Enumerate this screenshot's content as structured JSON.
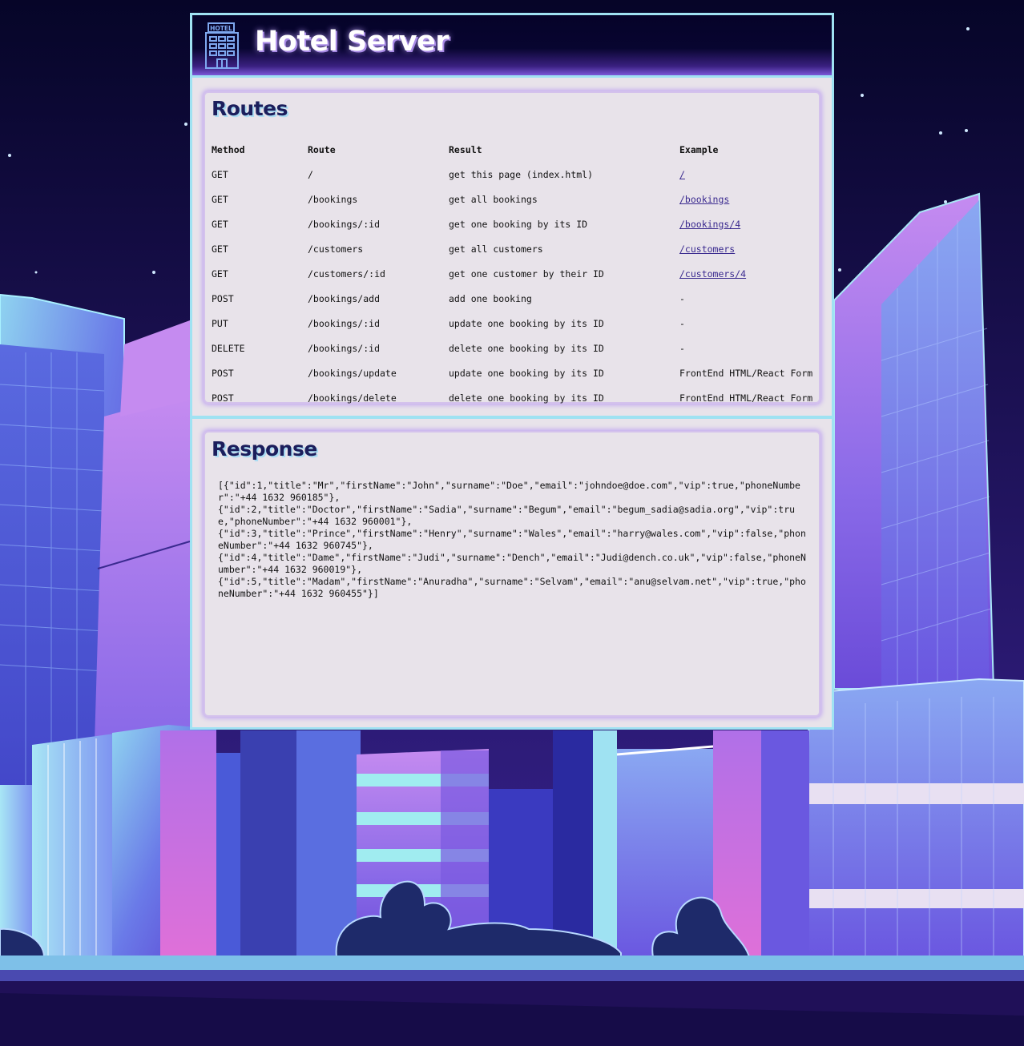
{
  "header": {
    "title": "Hotel Server",
    "icon_label": "HOTEL",
    "icon": "hotel-building-icon"
  },
  "routes": {
    "heading": "Routes",
    "columns": [
      "Method",
      "Route",
      "Result",
      "Example"
    ],
    "rows": [
      {
        "method": "GET",
        "route": "/",
        "result": "get this page (index.html)",
        "example": "/",
        "example_is_link": true
      },
      {
        "method": "GET",
        "route": "/bookings",
        "result": "get all bookings",
        "example": "/bookings",
        "example_is_link": true
      },
      {
        "method": "GET",
        "route": "/bookings/:id",
        "result": "get one booking by its ID",
        "example": "/bookings/4",
        "example_is_link": true
      },
      {
        "method": "GET",
        "route": "/customers",
        "result": "get all customers",
        "example": "/customers",
        "example_is_link": true
      },
      {
        "method": "GET",
        "route": "/customers/:id",
        "result": "get one customer by their ID",
        "example": "/customers/4",
        "example_is_link": true
      },
      {
        "method": "POST",
        "route": "/bookings/add",
        "result": "add one booking",
        "example": "-",
        "example_is_link": false
      },
      {
        "method": "PUT",
        "route": "/bookings/:id",
        "result": "update one booking by its ID",
        "example": "-",
        "example_is_link": false
      },
      {
        "method": "DELETE",
        "route": "/bookings/:id",
        "result": "delete one booking by its ID",
        "example": "-",
        "example_is_link": false
      },
      {
        "method": "POST",
        "route": "/bookings/update",
        "result": "update one booking by its ID",
        "example": "FrontEnd HTML/React Form",
        "example_is_link": false
      },
      {
        "method": "POST",
        "route": "/bookings/delete",
        "result": "delete one booking by its ID",
        "example": "FrontEnd HTML/React Form",
        "example_is_link": false
      }
    ]
  },
  "response": {
    "heading": "Response",
    "body": "[{\"id\":1,\"title\":\"Mr\",\"firstName\":\"John\",\"surname\":\"Doe\",\"email\":\"johndoe@doe.com\",\"vip\":true,\"phoneNumber\":\"+44 1632 960185\"},\n{\"id\":2,\"title\":\"Doctor\",\"firstName\":\"Sadia\",\"surname\":\"Begum\",\"email\":\"begum_sadia@sadia.org\",\"vip\":true,\"phoneNumber\":\"+44 1632 960001\"},\n{\"id\":3,\"title\":\"Prince\",\"firstName\":\"Henry\",\"surname\":\"Wales\",\"email\":\"harry@wales.com\",\"vip\":false,\"phoneNumber\":\"+44 1632 960745\"},\n{\"id\":4,\"title\":\"Dame\",\"firstName\":\"Judi\",\"surname\":\"Dench\",\"email\":\"Judi@dench.co.uk\",\"vip\":false,\"phoneNumber\":\"+44 1632 960019\"},\n{\"id\":5,\"title\":\"Madam\",\"firstName\":\"Anuradha\",\"surname\":\"Selvam\",\"email\":\"anu@selvam.net\",\"vip\":true,\"phoneNumber\":\"+44 1632 960455\"}]"
  },
  "theme": {
    "accent_cyan": "#9fe2f2",
    "panel_bg": "#e8e3ea",
    "heading_color": "#1c1e5c",
    "link_color": "#3a2a8f",
    "card_glow": "#c2a9f0"
  }
}
